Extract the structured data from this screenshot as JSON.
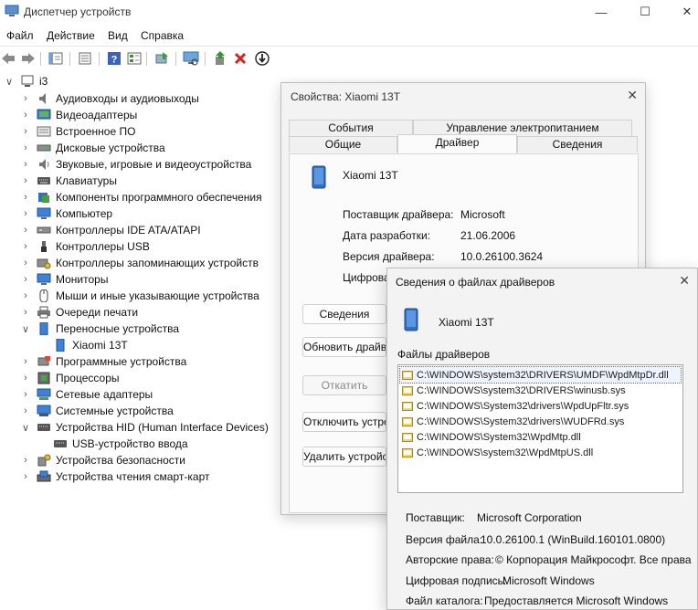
{
  "window": {
    "title": "Диспетчер устройств",
    "minimize": "—",
    "maximize": "☐",
    "close": "✕"
  },
  "menu": [
    "Файл",
    "Действие",
    "Вид",
    "Справка"
  ],
  "toolbar": {
    "icons": [
      "back-icon",
      "forward-icon",
      "show-hide-icon",
      "properties-icon",
      "help-icon",
      "view-icon",
      "update-driver-icon",
      "scan-hardware-icon",
      "enable-device-icon",
      "uninstall-icon",
      "disable-icon"
    ]
  },
  "tree": {
    "root": "i3",
    "categories": [
      "Аудиовходы и аудиовыходы",
      "Видеоадаптеры",
      "Встроенное ПО",
      "Дисковые устройства",
      "Звуковые, игровые и видеоустройства",
      "Клавиатуры",
      "Компоненты программного обеспечения",
      "Компьютер",
      "Контроллеры IDE ATA/ATAPI",
      "Контроллеры USB",
      "Контроллеры запоминающих устройств",
      "Мониторы",
      "Мыши и иные указывающие устройства",
      "Очереди печати",
      "Переносные устройства",
      "Xiaomi 13T",
      "Программные устройства",
      "Процессоры",
      "Сетевые адаптеры",
      "Системные устройства",
      "Устройства HID (Human Interface Devices)",
      "USB-устройство ввода",
      "Устройства безопасности",
      "Устройства чтения смарт-карт"
    ]
  },
  "properties": {
    "title": "Свойства: Xiaomi 13T",
    "close": "✕",
    "tabs_top": [
      "События",
      "Управление электропитанием"
    ],
    "tabs_bottom": [
      "Общие",
      "Драйвер",
      "Сведения"
    ],
    "device_name": "Xiaomi 13T",
    "rows": [
      {
        "label": "Поставщик драйвера:",
        "value": "Microsoft"
      },
      {
        "label": "Дата разработки:",
        "value": "21.06.2006"
      },
      {
        "label": "Версия драйвера:",
        "value": "10.0.26100.3624"
      },
      {
        "label": "Цифрова",
        "value": ""
      }
    ],
    "buttons": [
      "Сведения",
      "Обновить драйве",
      "Откатить",
      "Отключить устрой",
      "Удалить устройс"
    ]
  },
  "files": {
    "title": "Сведения о файлах драйверов",
    "close": "✕",
    "device_name": "Xiaomi 13T",
    "list_label": "Файлы драйверов",
    "list": [
      "C:\\WINDOWS\\system32\\DRIVERS\\UMDF\\WpdMtpDr.dll",
      "C:\\WINDOWS\\system32\\DRIVERS\\winusb.sys",
      "C:\\WINDOWS\\System32\\drivers\\WpdUpFltr.sys",
      "C:\\WINDOWS\\System32\\drivers\\WUDFRd.sys",
      "C:\\WINDOWS\\System32\\WpdMtp.dll",
      "C:\\WINDOWS\\system32\\WpdMtpUS.dll"
    ],
    "details": [
      {
        "label": "Поставщик:",
        "value": "Microsoft Corporation"
      },
      {
        "label": "Версия файла:",
        "value": "10.0.26100.1 (WinBuild.160101.0800)"
      },
      {
        "label": "Авторские права:",
        "value": "© Корпорация Майкрософт. Все права"
      },
      {
        "label": "Цифровая подпись:",
        "value": "Microsoft Windows"
      },
      {
        "label": "Файл каталога:",
        "value": "Предоставляется Microsoft Windows"
      }
    ]
  }
}
